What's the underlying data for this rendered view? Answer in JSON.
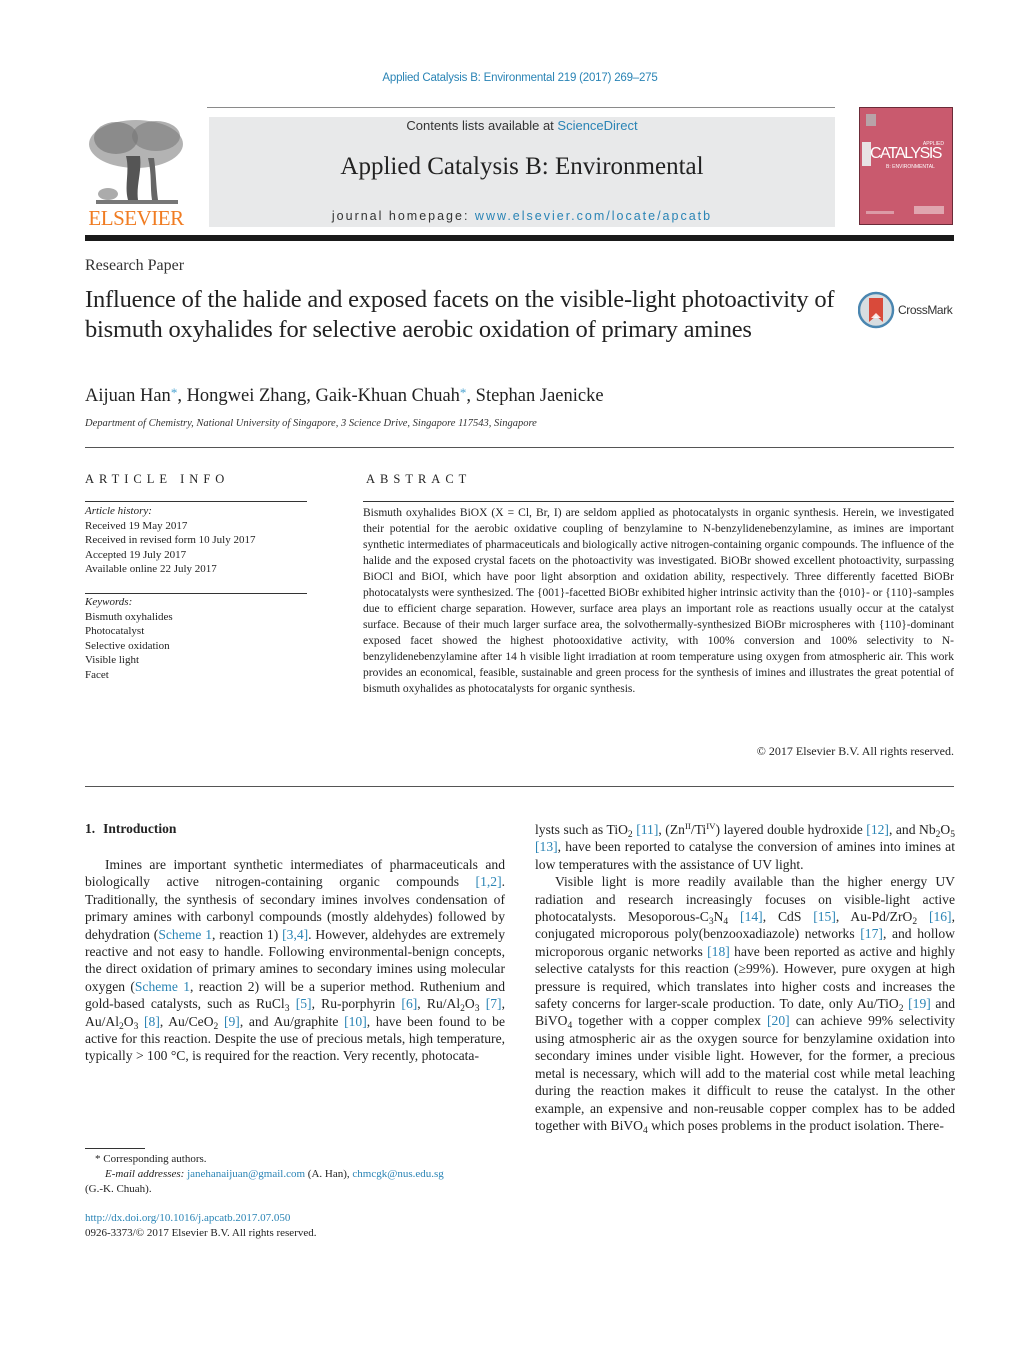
{
  "header": {
    "citation": "Applied Catalysis B: Environmental 219 (2017) 269–275",
    "publisher_logo_text": "ELSEVIER",
    "contents_prefix": "Contents lists available at ",
    "contents_link": "ScienceDirect",
    "journal_name": "Applied Catalysis B: Environmental",
    "homepage_prefix": "journal homepage: ",
    "homepage_link": "www.elsevier.com/locate/apcatb",
    "cover": {
      "title": "CATALYSIS",
      "small_top": "APPLIED",
      "subtitle": "B: ENVIRONMENTAL",
      "color": "#c95a6e"
    }
  },
  "article": {
    "type": "Research Paper",
    "title": "Influence of the halide and exposed facets on the visible-light photoactivity of bismuth oxyhalides for selective aerobic oxidation of primary amines",
    "crossmark_label": "CrossMark",
    "authors": [
      {
        "name": "Aijuan Han",
        "corresponding": true
      },
      {
        "name": "Hongwei Zhang",
        "corresponding": false
      },
      {
        "name": "Gaik-Khuan Chuah",
        "corresponding": true
      },
      {
        "name": "Stephan Jaenicke",
        "corresponding": false
      }
    ],
    "author_separator": ", ",
    "corresponding_mark": "*",
    "affiliation": "Department of Chemistry, National University of Singapore, 3 Science Drive, Singapore 117543, Singapore"
  },
  "article_info": {
    "heading": "ARTICLE INFO",
    "history_label": "Article history:",
    "history": [
      "Received 19 May 2017",
      "Received in revised form 10 July 2017",
      "Accepted 19 July 2017",
      "Available online 22 July 2017"
    ],
    "keywords_label": "Keywords:",
    "keywords": [
      "Bismuth oxyhalides",
      "Photocatalyst",
      "Selective oxidation",
      "Visible light",
      "Facet"
    ]
  },
  "abstract": {
    "heading": "ABSTRACT",
    "text": "Bismuth oxyhalides BiOX (X = Cl, Br, I) are seldom applied as photocatalysts in organic synthesis. Herein, we investigated their potential for the aerobic oxidative coupling of benzylamine to N-benzylidenebenzylamine, as imines are important synthetic intermediates of pharmaceuticals and biologically active nitrogen-containing organic compounds. The influence of the halide and the exposed crystal facets on the photoactivity was investigated. BiOBr showed excellent photoactivity, surpassing BiOCl and BiOI, which have poor light absorption and oxidation ability, respectively. Three differently facetted BiOBr photocatalysts were synthesized. The {001}-facetted BiOBr exhibited higher intrinsic activity than the {010}- or {110}-samples due to efficient charge separation. However, surface area plays an important role as reactions usually occur at the catalyst surface. Because of their much larger surface area, the solvothermally-synthesized BiOBr microspheres with {110}-dominant exposed facet showed the highest photooxidative activity, with 100% conversion and 100% selectivity to N-benzylidenebenzylamine after 14 h visible light irradiation at room temperature using oxygen from atmospheric air. This work provides an economical, feasible, sustainable and green process for the synthesis of imines and illustrates the great potential of bismuth oxyhalides as photocatalysts for organic synthesis.",
    "copyright": "© 2017 Elsevier B.V. All rights reserved."
  },
  "introduction": {
    "number": "1.",
    "heading": "Introduction",
    "left_column": {
      "p1_a": "Imines are important synthetic intermediates of pharmaceuticals and biologically active nitrogen-containing organic compounds ",
      "ref_1_2": "[1,2]",
      "p1_b": ". Traditionally, the synthesis of secondary imines involves condensation of primary amines with carbonyl compounds (mostly aldehydes) followed by dehydration (",
      "scheme1_a": "Scheme 1",
      "p1_c": ", reaction 1) ",
      "ref_3_4": "[3,4]",
      "p1_d": ". However, aldehydes are extremely reactive and not easy to handle. Following environmental-benign concepts, the direct oxidation of primary amines to secondary imines using molecular oxygen (",
      "scheme1_b": "Scheme 1",
      "p1_e": ", reaction 2) will be a superior method. Ruthenium and gold-based catalysts, such as RuCl",
      "p1_f": " ",
      "ref_5": "[5]",
      "p1_g": ", Ru-porphyrin ",
      "ref_6": "[6]",
      "p1_h": ", Ru/Al",
      "ref_7": "[7]",
      "p1_i": ", Au/Al",
      "ref_8": "[8]",
      "p1_j": ", Au/CeO",
      "ref_9": "[9]",
      "p1_k": ", and Au/graphite ",
      "ref_10": "[10]",
      "p1_l": ", have been found to be active for this reaction. Despite the use of precious metals, high temperature, typically > 100 °C, is required for the reaction. Very recently, photocata-"
    },
    "right_column": {
      "p1_a": "lysts such as TiO",
      "ref_11": "[11]",
      "p1_b": ", (Zn",
      "p1_c": "/Ti",
      "p1_d": ") layered double hydroxide ",
      "ref_12": "[12]",
      "p1_e": ", and Nb",
      "ref_13": "[13]",
      "p1_f": ", have been reported to catalyse the conversion of amines into imines at low temperatures with the assistance of UV light.",
      "p2_a": "Visible light is more readily available than the higher energy UV radiation and research increasingly focuses on visible-light active photocatalysts. Mesoporous-C",
      "ref_14": "[14]",
      "p2_b": ", CdS ",
      "ref_15": "[15]",
      "p2_c": ", Au-Pd/ZrO",
      "ref_16": "[16]",
      "p2_d": ", conjugated microporous poly(benzooxadiazole) networks ",
      "ref_17": "[17]",
      "p2_e": ", and hollow microporous organic networks ",
      "ref_18": "[18]",
      "p2_f": " have been reported as active and highly selective catalysts for this reaction (≥99%). However, pure oxygen at high pressure is required, which translates into higher costs and increases the safety concerns for larger-scale production. To date, only Au/TiO",
      "ref_19": "[19]",
      "p2_g": " and BiVO",
      "p2_h": " together with a copper complex ",
      "ref_20": "[20]",
      "p2_i": " can achieve 99% selectivity using atmospheric air as the oxygen source for benzylamine oxidation into secondary imines under visible light. However, for the former, a precious metal is necessary, which will add to the material cost while metal leaching during the reaction makes it difficult to reuse the catalyst. In the other example, an expensive and non-reusable copper complex has to be added together with BiVO",
      "p2_j": " which poses problems in the product isolation. There-"
    }
  },
  "footnotes": {
    "corresponding": "* Corresponding authors.",
    "email_label": "E-mail addresses:",
    "email_1": "janehanaijuan@gmail.com",
    "email_1_owner": " (A. Han), ",
    "email_2": "chmcgk@nus.edu.sg",
    "email_2_owner": "(G.-K. Chuah).",
    "doi": "http://dx.doi.org/10.1016/j.apcatb.2017.07.050",
    "issn_copyright": "0926-3373/© 2017 Elsevier B.V. All rights reserved."
  },
  "colors": {
    "link": "#2a84b5",
    "elsevier_orange": "#f07c22",
    "banner_bg": "#e8e9ea",
    "crossmark_red": "#d94a3a"
  }
}
